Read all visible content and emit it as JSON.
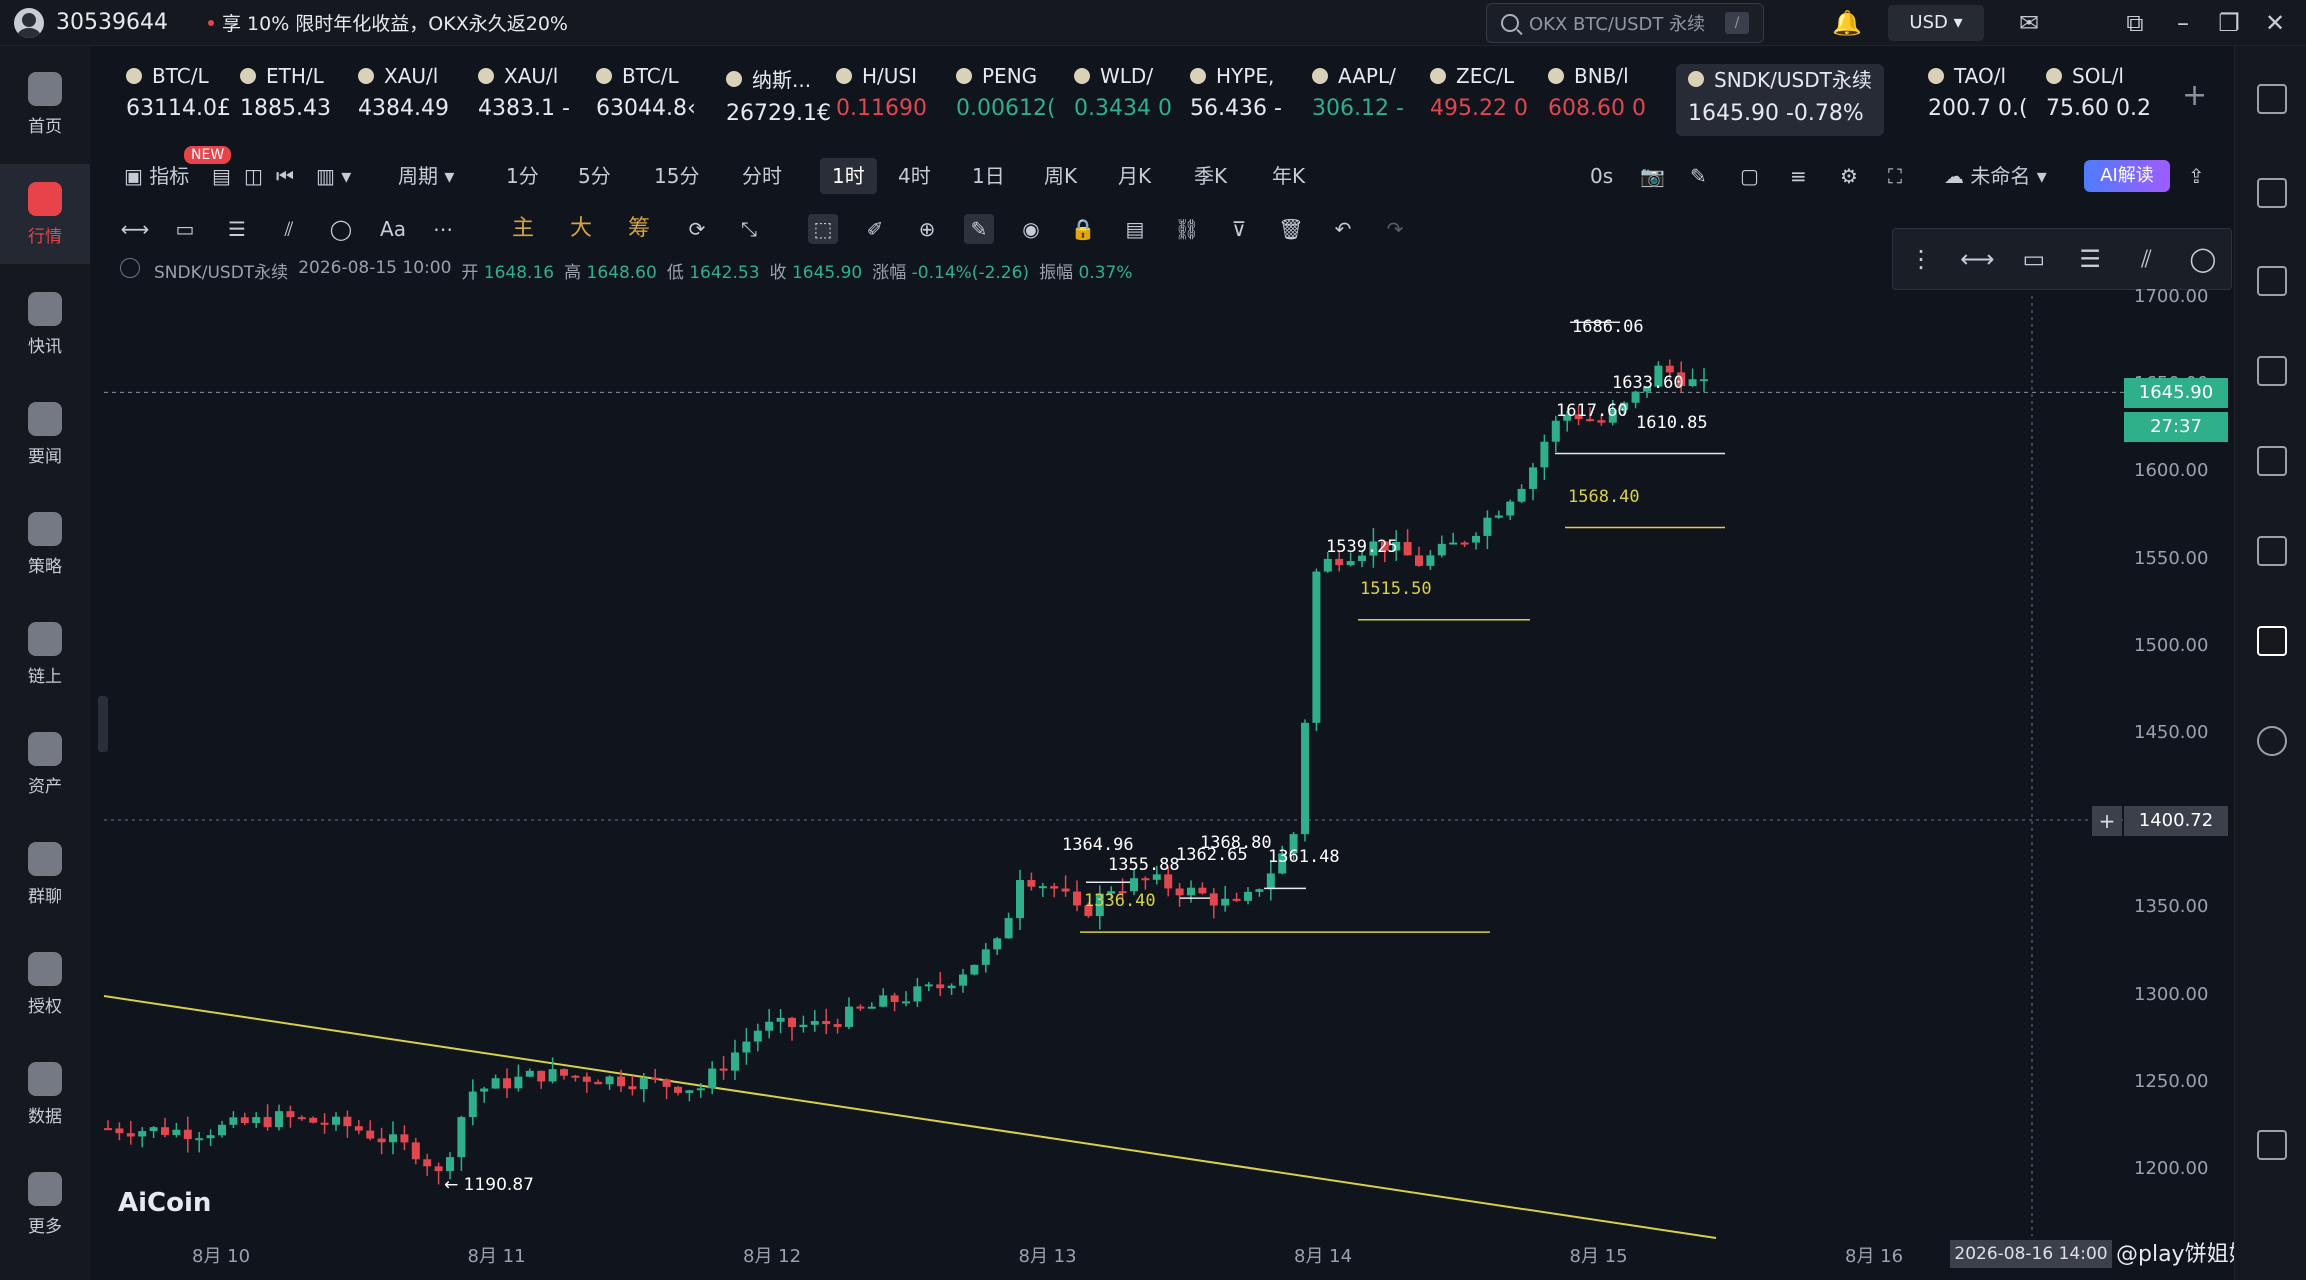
{
  "topbar": {
    "user_id": "30539644",
    "promo": "享 10% 限时年化收益，OKX永久返20%",
    "search_placeholder": "OKX BTC/USDT 永续",
    "search_shortcut": "/",
    "currency": "USD ▾"
  },
  "sidebar": {
    "items": [
      {
        "label": "首页",
        "icon": "home-icon"
      },
      {
        "label": "行情",
        "icon": "market-icon",
        "active": true
      },
      {
        "label": "快讯",
        "icon": "news-flash-icon"
      },
      {
        "label": "要闻",
        "icon": "headlines-icon"
      },
      {
        "label": "策略",
        "icon": "robot-icon"
      },
      {
        "label": "链上",
        "icon": "onchain-icon"
      },
      {
        "label": "资产",
        "icon": "wallet-icon"
      },
      {
        "label": "群聊",
        "icon": "chat-icon"
      },
      {
        "label": "授权",
        "icon": "auth-icon"
      },
      {
        "label": "数据",
        "icon": "data-icon"
      },
      {
        "label": "更多",
        "icon": "more-grid-icon"
      }
    ]
  },
  "tickers": [
    {
      "name": "BTC/L",
      "price": "63114.0£",
      "color": "white"
    },
    {
      "name": "ETH/L",
      "price": "1885.43",
      "color": "white"
    },
    {
      "name": "XAU/l",
      "price": "4384.49",
      "color": "white"
    },
    {
      "name": "XAU/l",
      "price": "4383.1 -",
      "color": "white"
    },
    {
      "name": "BTC/L",
      "price": "63044.8‹",
      "color": "white"
    },
    {
      "name": "纳斯...",
      "price": "26729.1€",
      "color": "white"
    },
    {
      "name": "H/USI",
      "price": "0.11690",
      "color": "red"
    },
    {
      "name": "PENG",
      "price": "0.00612(",
      "color": "green"
    },
    {
      "name": "WLD/",
      "price": "0.3434 0",
      "color": "green"
    },
    {
      "name": "HYPE,",
      "price": "56.436 -",
      "color": "white"
    },
    {
      "name": "AAPL/",
      "price": "306.12 -",
      "color": "green"
    },
    {
      "name": "ZEC/L",
      "price": "495.22 0",
      "color": "red"
    },
    {
      "name": "BNB/l",
      "price": "608.60 0",
      "color": "red"
    },
    {
      "name": "SNDK/USDT永续",
      "price": "1645.90 -0.78%",
      "color": "white",
      "selected": true
    },
    {
      "name": "TAO/l",
      "price": "200.7 0.(",
      "color": "white"
    },
    {
      "name": "SOL/l",
      "price": "75.60 0.2",
      "color": "white"
    }
  ],
  "toolbar": {
    "indicators": "指标",
    "new_badge": "NEW",
    "period": "周期",
    "intervals": [
      "1分",
      "5分",
      "15分",
      "分时",
      "1时",
      "4时",
      "1日",
      "周K",
      "月K",
      "季K",
      "年K"
    ],
    "active_interval": "1时",
    "countdown": "0s",
    "layout_name": "未命名",
    "ai_button": "AI解读",
    "draw_labels": [
      "主",
      "大",
      "筹"
    ]
  },
  "ohlc": {
    "symbol": "SNDK/USDT永续",
    "datetime": "2026-08-15 10:00",
    "open_label": "开",
    "open": "1648.16",
    "high_label": "高",
    "high": "1648.60",
    "low_label": "低",
    "low": "1642.53",
    "close_label": "收",
    "close": "1645.90",
    "change_label": "涨幅",
    "change": "-0.14%(-2.26)",
    "amp_label": "振幅",
    "amp": "0.37%"
  },
  "price_axis": {
    "ticks": [
      "1700.00",
      "1650.00",
      "1600.00",
      "1550.00",
      "1500.00",
      "1450.00",
      "1400.00",
      "1350.00",
      "1300.00",
      "1250.00",
      "1200.00"
    ],
    "last_price": "1645.90",
    "countdown": "27:37",
    "crosshair_price": "1400.72"
  },
  "time_axis": {
    "ticks": [
      "8月 10",
      "8月 11",
      "8月 12",
      "8月 13",
      "8月 14",
      "8月 15",
      "8月 16"
    ],
    "crosshair_time": "2026-08-16 14:00"
  },
  "annotations": {
    "low_marker": "← 1190.87",
    "levels": [
      "1364.96",
      "1355.88",
      "1368.80",
      "1362.65",
      "1361.48",
      "1336.40",
      "1539.25",
      "1515.50",
      "1633.60",
      "1617.60",
      "1610.85",
      "1568.40",
      "1686.06"
    ]
  },
  "brand": "AiCoin",
  "watermark": "@play饼姐姐",
  "colors": {
    "up": "#2fb08a",
    "down": "#e0474e",
    "trendline": "#d8d04a",
    "background": "#10141d"
  }
}
